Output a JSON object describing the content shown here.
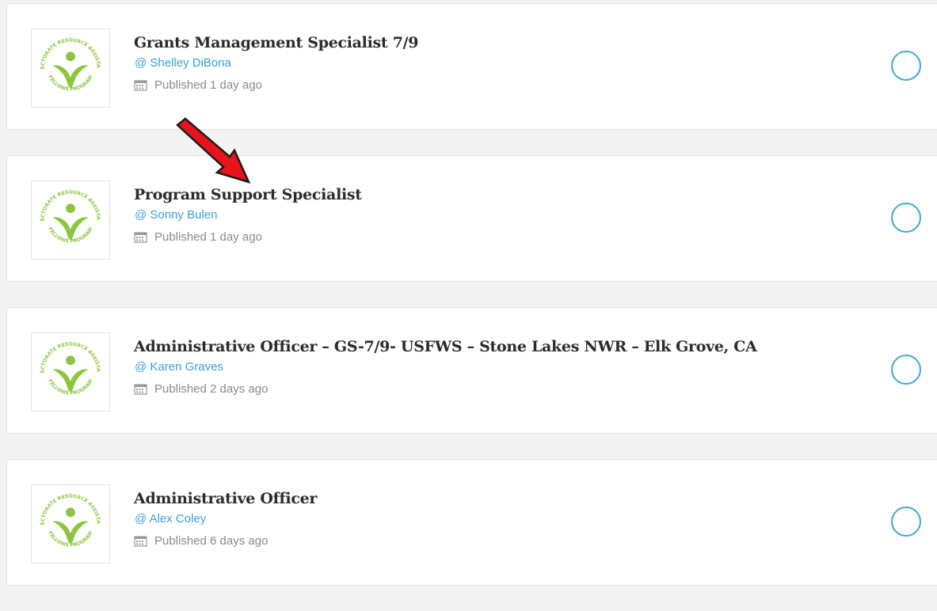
{
  "jobs": [
    {
      "title": "Grants Management Specialist 7/9",
      "author": "@ Shelley DiBona",
      "published": "Published 1 day ago"
    },
    {
      "title": "Program Support Specialist",
      "author": "@ Sonny Bulen",
      "published": "Published 1 day ago"
    },
    {
      "title": "Administrative Officer – GS-7/9- USFWS – Stone Lakes NWR – Elk Grove, CA",
      "author": "@ Karen Graves",
      "published": "Published 2 days ago"
    },
    {
      "title": "Administrative Officer",
      "author": "@ Alex Coley",
      "published": "Published 6 days ago"
    }
  ],
  "logo": {
    "top_text": "DIRECTORATE RESOURCE ASSISTANTS",
    "bottom_text": "FELLOWS PROGRAM",
    "color": "#8cc63f"
  },
  "icons": {
    "published": "calendar-icon",
    "select": "radio-circle-icon",
    "annotation": "red-arrow-icon"
  },
  "colors": {
    "author": "#3aa0d8",
    "select_circle": "#41a8d6",
    "arrow": "#e8141a"
  }
}
